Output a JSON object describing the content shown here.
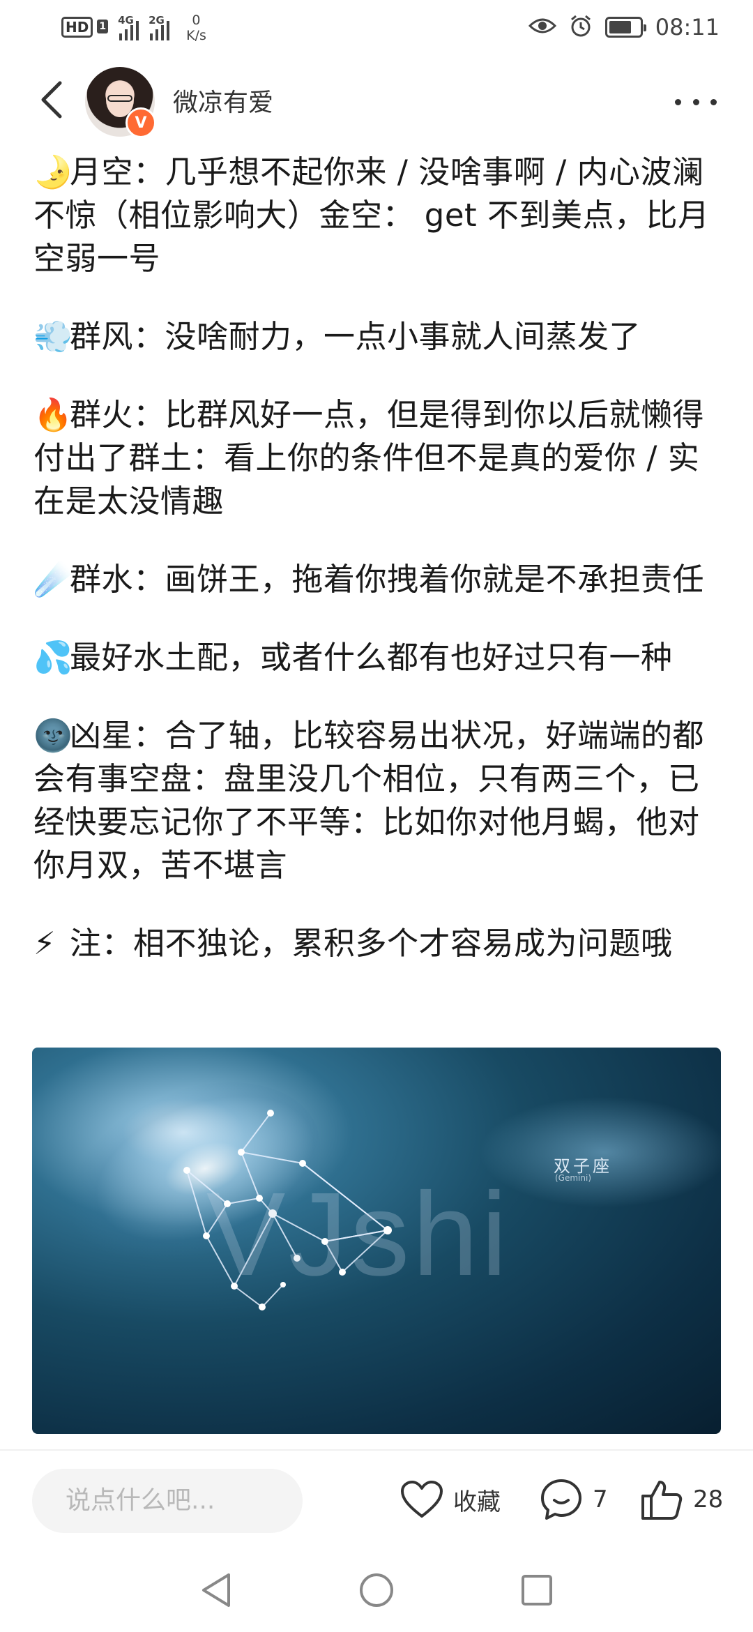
{
  "status_bar": {
    "hd": "HD",
    "sim1_tag": "4G",
    "sim2_tag": "2G",
    "net_speed_value": "0",
    "net_speed_unit": "K/s",
    "battery_level": 0.75,
    "time": "08:11",
    "icons": [
      "eye-icon",
      "alarm-icon",
      "battery-icon"
    ]
  },
  "header": {
    "username": "微凉有爱",
    "vip_badge": "V"
  },
  "post": {
    "paragraphs": [
      {
        "emoji": "🌛",
        "text": "月空：几乎想不起你来 / 没啥事啊 / 内心波澜不惊（相位影响大）金空： get 不到美点，比月空弱一号"
      },
      {
        "emoji": "💨",
        "text": "群风：没啥耐力，一点小事就人间蒸发了"
      },
      {
        "emoji": "🔥",
        "text": "群火：比群风好一点，但是得到你以后就懒得付出了群土：看上你的条件但不是真的爱你 / 实在是太没情趣"
      },
      {
        "emoji": "☄️",
        "text": "群水：画饼王，拖着你拽着你就是不承担责任"
      },
      {
        "emoji": "💦",
        "text": "最好水土配，或者什么都有也好过只有一种"
      },
      {
        "emoji": "🌚",
        "text": "凶星：合了轴，比较容易出状况，好端端的都会有事空盘：盘里没几个相位，只有两三个，已经快要忘记你了不平等：比如你对他月蝎，他对你月双，苦不堪言"
      },
      {
        "emoji": "⚡",
        "text": "注：相不独论，累积多个才容易成为问题哦"
      }
    ],
    "image": {
      "watermark": "VJshi",
      "constellation_label": "双子座",
      "constellation_sub": "(Gemini)"
    }
  },
  "action_bar": {
    "comment_placeholder": "说点什么吧...",
    "favorite_label": "收藏",
    "comment_count": "7",
    "like_count": "28"
  }
}
